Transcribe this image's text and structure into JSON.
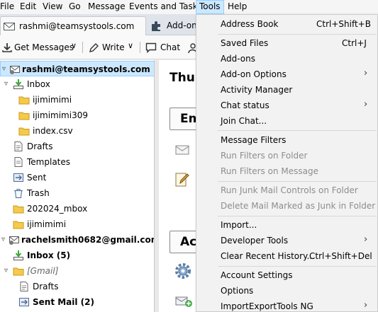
{
  "menubar": [
    {
      "label": "File"
    },
    {
      "label": "Edit"
    },
    {
      "label": "View"
    },
    {
      "label": "Go"
    },
    {
      "label": "Message"
    },
    {
      "label": "Events and Tasks"
    },
    {
      "label": "Tools"
    },
    {
      "label": "Help"
    }
  ],
  "tabs": [
    {
      "label": "rashmi@teamsystools.com"
    },
    {
      "label": "Add-on"
    }
  ],
  "toolbar": {
    "get_messages": "Get Messages",
    "write": "Write",
    "chat": "Chat"
  },
  "folders": [
    {
      "label": "rashmi@teamsystools.com"
    },
    {
      "label": "Inbox"
    },
    {
      "label": "ijimimimi"
    },
    {
      "label": "ijimimimi309"
    },
    {
      "label": "index.csv"
    },
    {
      "label": "Drafts"
    },
    {
      "label": "Templates"
    },
    {
      "label": "Sent"
    },
    {
      "label": "Trash"
    },
    {
      "label": "202024_mbox"
    },
    {
      "label": "ijimimimi"
    },
    {
      "label": "rachelsmith0682@gmail.com"
    },
    {
      "label": "Inbox (5)"
    },
    {
      "label": "[Gmail]"
    },
    {
      "label": "Drafts"
    },
    {
      "label": "Sent Mail (2)"
    }
  ],
  "main": {
    "heading": "Thur",
    "email_button": "Em",
    "accounts_button": "Ac"
  },
  "tools_menu": [
    {
      "label": "Address Book",
      "shortcut": "Ctrl+Shift+B"
    },
    {
      "label": "Saved Files",
      "shortcut": "Ctrl+J"
    },
    {
      "label": "Add-ons"
    },
    {
      "label": "Add-on Options"
    },
    {
      "label": "Activity Manager"
    },
    {
      "label": "Chat status"
    },
    {
      "label": "Join Chat..."
    },
    {
      "label": "Message Filters"
    },
    {
      "label": "Run Filters on Folder"
    },
    {
      "label": "Run Filters on Message"
    },
    {
      "label": "Run Junk Mail Controls on Folder"
    },
    {
      "label": "Delete Mail Marked as Junk in Folder"
    },
    {
      "label": "Import..."
    },
    {
      "label": "Developer Tools"
    },
    {
      "label": "Clear Recent History...",
      "shortcut": "Ctrl+Shift+Del"
    },
    {
      "label": "Account Settings"
    },
    {
      "label": "Options"
    },
    {
      "label": "ImportExportTools NG"
    }
  ],
  "colors": {
    "selection": "#cce8ff",
    "selection_border": "#99d1ff",
    "folder_yellow": "#f5c94a",
    "inbox_green": "#3aa635",
    "disabled_text": "#8d8d8d"
  }
}
